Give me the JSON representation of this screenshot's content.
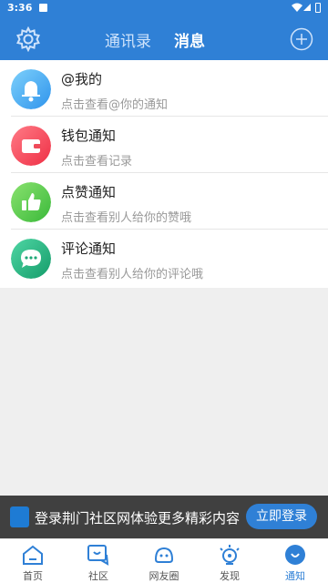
{
  "status": {
    "time": "3:36"
  },
  "header": {
    "tabs": {
      "contacts": "通讯录",
      "messages": "消息"
    }
  },
  "notifications": [
    {
      "title": "@我的",
      "subtitle": "点击查看@你的通知",
      "icon": "bell-icon",
      "color": "#39a7f0"
    },
    {
      "title": "钱包通知",
      "subtitle": "点击查看记录",
      "icon": "wallet-icon",
      "color": "#f24c5a"
    },
    {
      "title": "点赞通知",
      "subtitle": "点击查看别人给你的赞哦",
      "icon": "thumbs-up-icon",
      "color": "#56c94b"
    },
    {
      "title": "评论通知",
      "subtitle": "点击查看别人给你的评论哦",
      "icon": "chat-bubble-icon",
      "color": "#22b07a"
    }
  ],
  "banner": {
    "text": "登录荆门社区网体验更多精彩内容",
    "button": "立即登录"
  },
  "nav": [
    {
      "label": "首页",
      "icon": "home-icon"
    },
    {
      "label": "社区",
      "icon": "community-icon"
    },
    {
      "label": "网友圈",
      "icon": "friends-circle-icon"
    },
    {
      "label": "发现",
      "icon": "discover-icon"
    },
    {
      "label": "通知",
      "icon": "notification-icon",
      "active": true
    }
  ],
  "colors": {
    "primary": "#2f80d6"
  }
}
